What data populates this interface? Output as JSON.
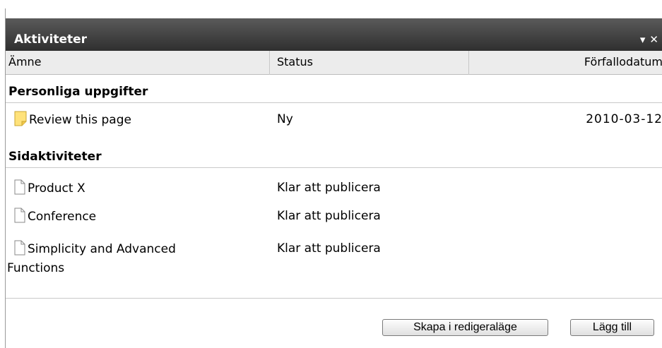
{
  "panel": {
    "title": "Aktiviteter",
    "controls": "▾ ✕"
  },
  "columns": {
    "subject": "Ämne",
    "status": "Status",
    "due": "Förfallodatum"
  },
  "sections": [
    {
      "title": "Personliga uppgifter",
      "rows": [
        {
          "name": "Review this page",
          "status": "Ny",
          "due": "2010-03-12",
          "icon": "note-icon"
        }
      ]
    },
    {
      "title": "Sidaktiviteter",
      "rows": [
        {
          "name": "Product X",
          "status": "Klar att publicera",
          "due": "",
          "icon": "page-icon"
        },
        {
          "name": "Conference",
          "status": "Klar att publicera",
          "due": "",
          "icon": "page-icon"
        },
        {
          "name": "Simplicity and Advanced Functions",
          "name_line1": "Simplicity and Advanced",
          "name_line2": "Functions",
          "status": "Klar att publicera",
          "due": "",
          "icon": "page-icon"
        }
      ]
    }
  ],
  "footer": {
    "edit_mode_button": "Skapa i redigeraläge",
    "add_button": "Lägg till"
  },
  "colors": {
    "titlebar": "#3f3f3f",
    "header_bg": "#ececec",
    "note_icon": "#ffe27a"
  }
}
